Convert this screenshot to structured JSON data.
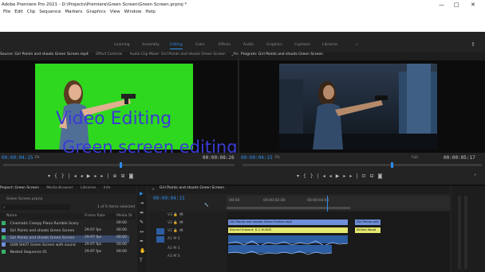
{
  "app": {
    "title": "Adobe Premiere Pro 2021 - D:\\Projects\\Premiere\\Green Screen\\Green Screen.prproj *",
    "menu": [
      "File",
      "Edit",
      "Clip",
      "Sequence",
      "Markers",
      "Graphics",
      "View",
      "Window",
      "Help"
    ],
    "window_controls": [
      "—",
      "□",
      "✕"
    ]
  },
  "workspaces": {
    "items": [
      "Learning",
      "Assembly",
      "Editing",
      "Color",
      "Effects",
      "Audio",
      "Graphics",
      "Captions",
      "Libraries"
    ],
    "active": "Editing",
    "more": "»"
  },
  "source_panel": {
    "tabs": [
      "Source: Girl Points and shoots Green Screen.mp4",
      "Effect Controls",
      "Audio Clip Mixer: Girl Points and shoots Green Screen",
      "Me"
    ],
    "more": "»",
    "timecode_in": "00:00:04:25",
    "fit": "Fit",
    "timecode_out": "00:00:08:26"
  },
  "program_panel": {
    "title": "Program: Girl Points and shoots Green Screen",
    "timecode_in": "00:00:04:15",
    "fit": "Fit",
    "quality": "Full",
    "timecode_out": "00:00:05:17"
  },
  "overlay_text": {
    "line1": "Video Editing",
    "line2": "Green screen editing"
  },
  "project_panel": {
    "tabs": [
      "Project: Green Screen",
      "Media Browser",
      "Libraries",
      "Info"
    ],
    "project_file": "Green Screen.prproj",
    "selection": "1 of 6 items selected",
    "columns": [
      "Name",
      "Frame Rate",
      "Media St"
    ],
    "rows": [
      {
        "name": "Cinematic Creepy Piano Rumble Scary",
        "rate": "",
        "start": "00:00"
      },
      {
        "name": "Girl Points and shoots Green Screen",
        "rate": "29.97 fps",
        "start": "00:00"
      },
      {
        "name": "Girl Points and shoots Green Screen",
        "rate": "29.97 fps",
        "start": "00:00"
      },
      {
        "name": "GUN SHOT Green Screen with sound",
        "rate": "29.97 fps",
        "start": "00:00"
      },
      {
        "name": "Nested Sequence 01",
        "rate": "29.97 fps",
        "start": "00:00"
      }
    ]
  },
  "timeline": {
    "tab": "Girl Points and shoots Green Screen",
    "timecode": "00:00:04:15",
    "ruler": [
      ":00:00",
      "00:00:02:00",
      "00:00:04:00"
    ],
    "tracks": [
      {
        "name": "V3",
        "label": ""
      },
      {
        "name": "V2",
        "label": ""
      },
      {
        "name": "V1",
        "label": ""
      },
      {
        "name": "A1",
        "label": "M S"
      },
      {
        "name": "A2",
        "label": "M S"
      },
      {
        "name": "A3",
        "label": "M S"
      }
    ],
    "clips": {
      "v2_main": "Girl Points and shoots Green Screen.mp4",
      "v2_end": "Girl Points and",
      "v1_main": "Blurred Edward: D-1 HLRGE",
      "v1_end": "Skilled Wood"
    }
  },
  "colors": {
    "accent": "#2d8ceb",
    "overlay_text": "#3a3ad6",
    "green_screen": "#2ed81f",
    "v2_clip": "#6f8fd8",
    "v1_clip": "#e5e86e",
    "audio_clip": "#2d5da3"
  },
  "icons": [
    "minimize-icon",
    "maximize-icon",
    "close-icon",
    "wrench-icon",
    "play-icon",
    "step-back-icon",
    "step-forward-icon",
    "camera-icon",
    "selection-tool-icon",
    "razor-tool-icon",
    "hand-tool-icon",
    "pen-tool-icon",
    "type-tool-icon",
    "search-icon",
    "folder-icon",
    "eye-icon",
    "lock-icon"
  ]
}
